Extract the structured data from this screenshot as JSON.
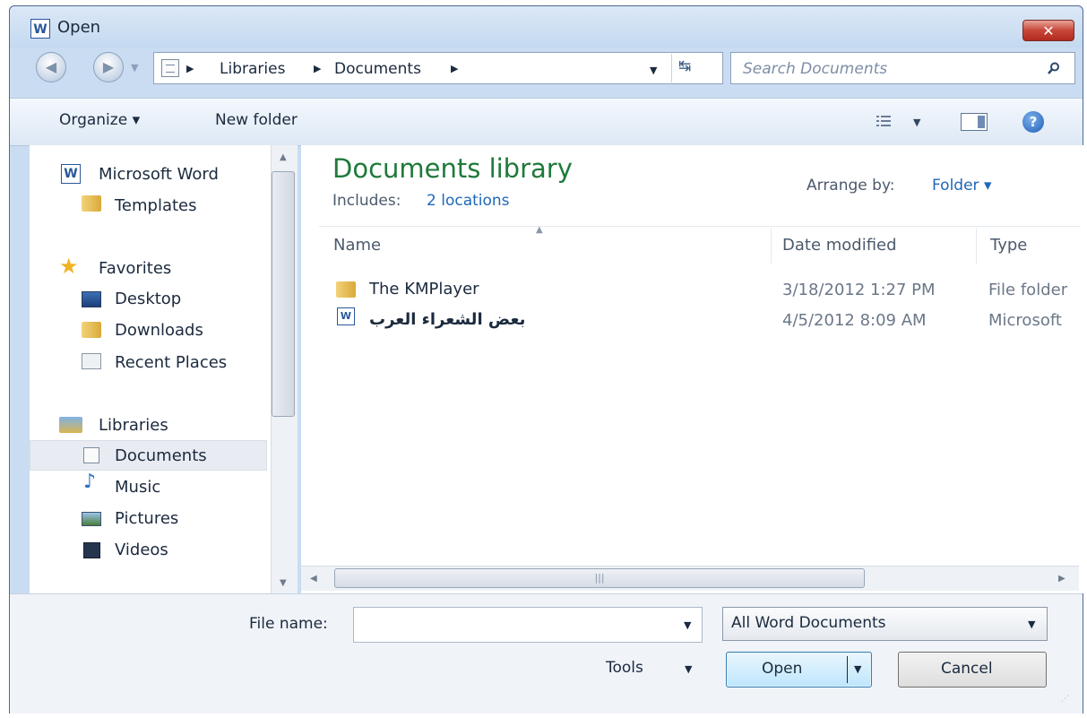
{
  "window": {
    "title": "Open",
    "app_icon_letter": "W",
    "close_label": "✕"
  },
  "address": {
    "crumbs": [
      "Libraries",
      "Documents"
    ],
    "search_placeholder": "Search Documents"
  },
  "toolbar": {
    "organize_label": "Organize ▾",
    "new_folder_label": "New folder",
    "help_label": "?"
  },
  "nav": {
    "app_group": {
      "label": "Microsoft Word",
      "items": [
        {
          "label": "Templates"
        }
      ]
    },
    "favorites": {
      "label": "Favorites",
      "items": [
        {
          "label": "Desktop"
        },
        {
          "label": "Downloads"
        },
        {
          "label": "Recent Places"
        }
      ]
    },
    "libraries": {
      "label": "Libraries",
      "items": [
        {
          "label": "Documents",
          "selected": true
        },
        {
          "label": "Music"
        },
        {
          "label": "Pictures"
        },
        {
          "label": "Videos"
        }
      ]
    }
  },
  "content": {
    "library_title": "Documents library",
    "includes_label": "Includes:",
    "includes_link": "2 locations",
    "arrange_label": "Arrange by:",
    "arrange_value": "Folder ▾",
    "columns": {
      "name": "Name",
      "date": "Date modified",
      "type": "Type"
    },
    "rows": [
      {
        "name": "The KMPlayer",
        "date": "3/18/2012 1:27 PM",
        "type": "File folder",
        "icon": "folder-icon"
      },
      {
        "name": "بعض الشعراء العرب",
        "date": "4/5/2012 8:09 AM",
        "type": "Microsoft",
        "icon": "word-doc-icon"
      }
    ]
  },
  "bottom": {
    "file_name_label": "File name:",
    "file_name_value": "",
    "filter_value": "All Word Documents",
    "tools_label": "Tools",
    "open_label": "Open",
    "cancel_label": "Cancel"
  },
  "colors": {
    "accent_title": "#1e7a3a",
    "link": "#1f67b9",
    "frame": "#c9dcf1",
    "close": "#c8463a"
  }
}
